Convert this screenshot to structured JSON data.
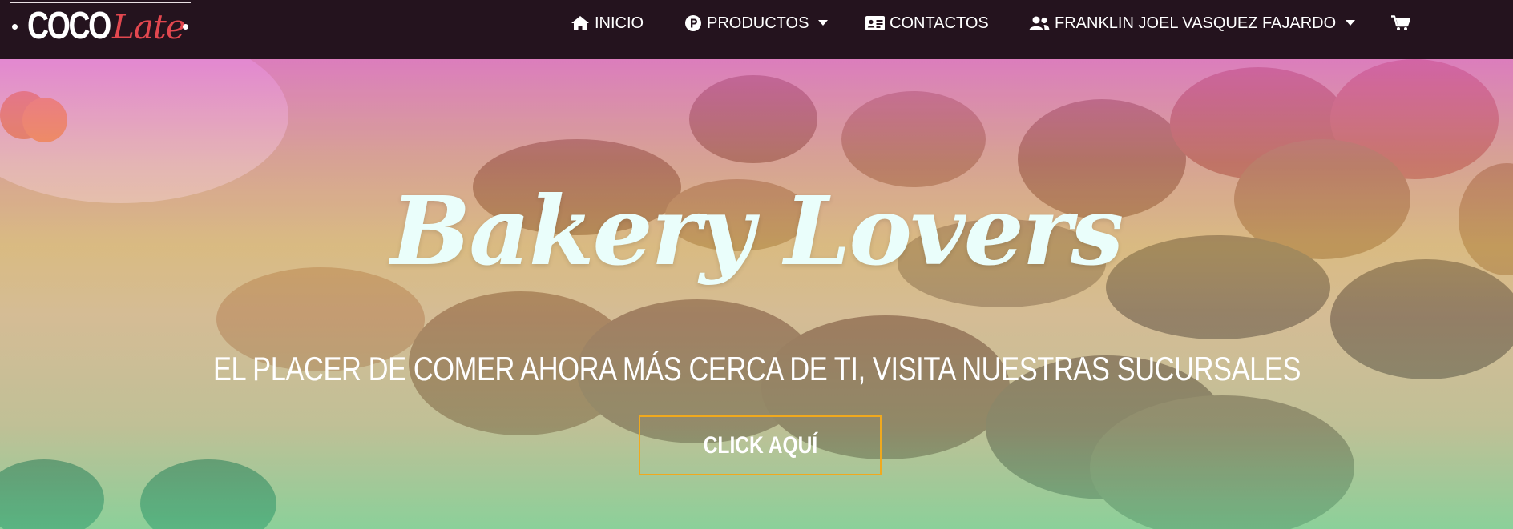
{
  "brand": {
    "part1": "COCO",
    "part2": "Late"
  },
  "nav": {
    "home_label": "INICIO",
    "products_label": "PRODUCTOS",
    "contacts_label": "CONTACTOS",
    "user_label": "FRANKLIN JOEL VASQUEZ FAJARDO",
    "icons": {
      "home": "home-icon",
      "products": "products-p-icon",
      "contacts": "id-card-icon",
      "user": "users-icon",
      "cart": "shopping-cart-icon",
      "dropdown": "caret-down-icon"
    }
  },
  "hero": {
    "title": "Bakery Lovers",
    "subtitle": "EL PLACER DE COMER AHORA MÁS CERCA DE TI, VISITA NUESTRAS SUCURSALES",
    "cta_label": "CLICK AQUÍ"
  },
  "colors": {
    "navbar_bg": "#24131e",
    "brand_accent": "#e2474f",
    "cta_border": "#f0a91e",
    "title_color": "#eafefb"
  }
}
